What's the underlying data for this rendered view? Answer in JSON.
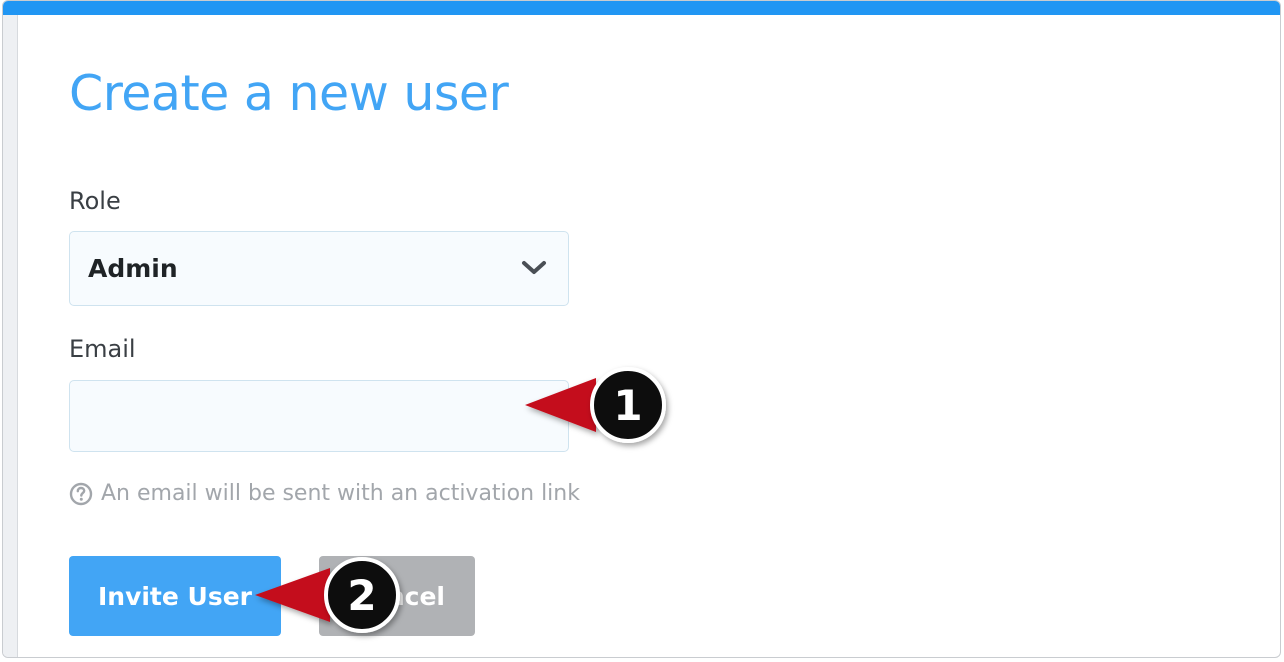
{
  "form": {
    "title": "Create a new user",
    "role_label": "Role",
    "role_selected": "Admin",
    "email_label": "Email",
    "email_value": "",
    "email_placeholder": "",
    "help_text": "An email will be sent with an activation link"
  },
  "buttons": {
    "invite_label": "Invite User",
    "cancel_label": "Cancel"
  },
  "annotations": [
    {
      "number": "1",
      "target": "email-field"
    },
    {
      "number": "2",
      "target": "invite-user-button"
    }
  ],
  "colors": {
    "accent": "#42a5f5",
    "top_bar": "#2196f3",
    "cancel_bg": "#b0b2b5",
    "arrow": "#c4101e",
    "badge": "#0a0a0a"
  },
  "icons": {
    "dropdown": "chevron-down-icon",
    "help": "question-circle-icon"
  }
}
